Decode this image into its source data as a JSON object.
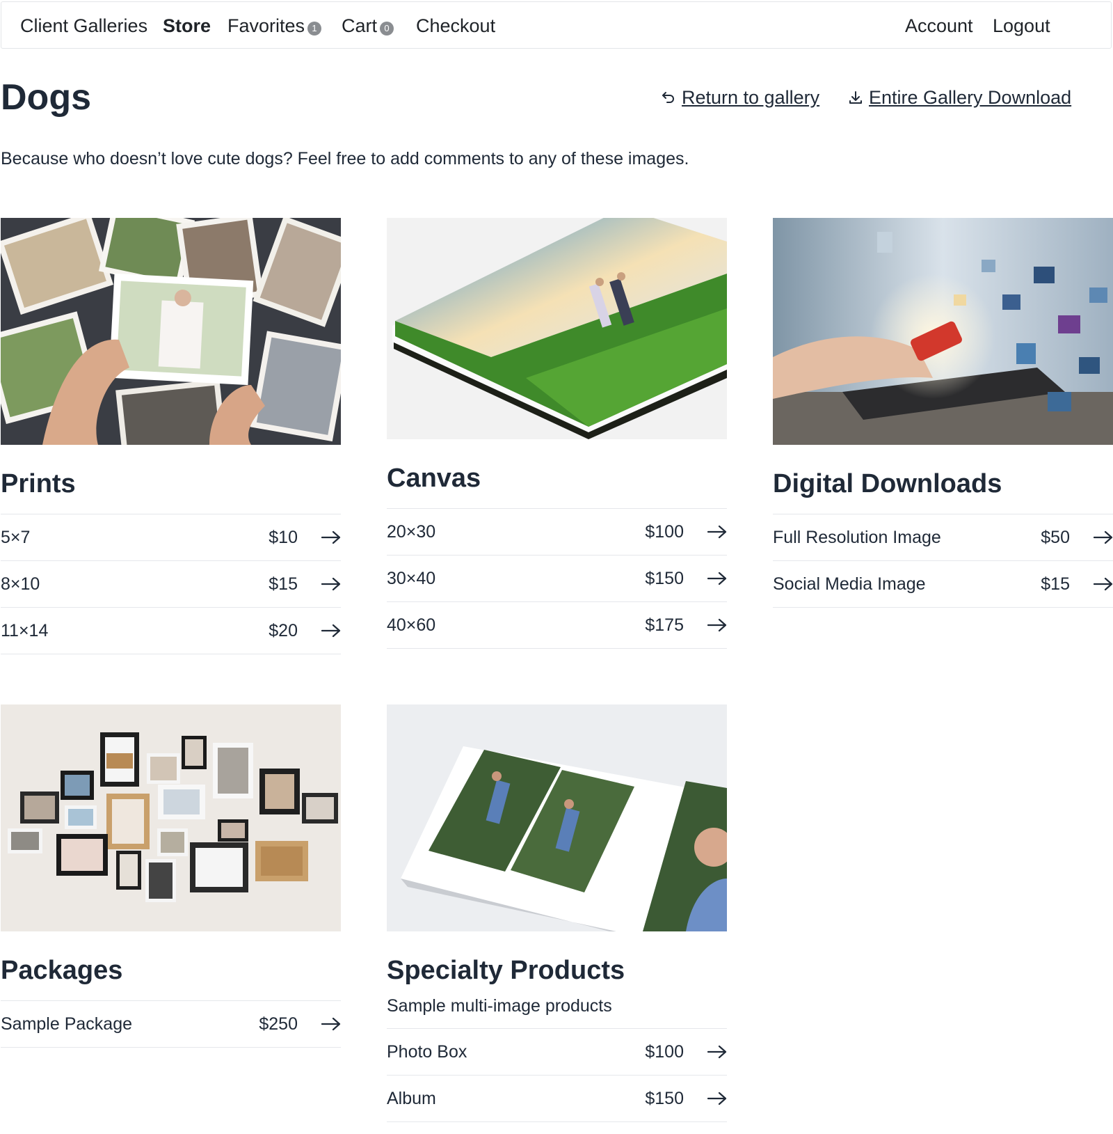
{
  "nav": {
    "items": [
      {
        "label": "Client Galleries"
      },
      {
        "label": "Store"
      },
      {
        "label": "Favorites",
        "badge": "1"
      },
      {
        "label": "Cart",
        "badge": "0"
      },
      {
        "label": "Checkout"
      }
    ],
    "account": "Account",
    "logout": "Logout"
  },
  "header": {
    "title": "Dogs",
    "return_link": "Return to gallery",
    "download_link": "Entire Gallery Download"
  },
  "description": "Because who doesn’t love cute dogs? Feel free to add comments to any of these images.",
  "products": [
    {
      "title": "Prints",
      "image": "prints-photo",
      "rows": [
        {
          "name": "5×7",
          "price": "$10"
        },
        {
          "name": "8×10",
          "price": "$15"
        },
        {
          "name": "11×14",
          "price": "$20"
        }
      ]
    },
    {
      "title": "Canvas",
      "image": "canvas-photo",
      "rows": [
        {
          "name": "20×30",
          "price": "$100"
        },
        {
          "name": "30×40",
          "price": "$150"
        },
        {
          "name": "40×60",
          "price": "$175"
        }
      ]
    },
    {
      "title": "Digital Downloads",
      "image": "digital-photo",
      "rows": [
        {
          "name": "Full Resolution Image",
          "price": "$50"
        },
        {
          "name": "Social Media Image",
          "price": "$15"
        }
      ]
    },
    {
      "title": "Packages",
      "image": "packages-photo",
      "rows": [
        {
          "name": "Sample Package",
          "price": "$250"
        }
      ]
    },
    {
      "title": "Specialty Products",
      "subtitle": "Sample multi-image products",
      "image": "specialty-photo",
      "rows": [
        {
          "name": "Photo Box",
          "price": "$100"
        },
        {
          "name": "Album",
          "price": "$150"
        }
      ]
    }
  ],
  "icons": {
    "return": "return-arrow-icon",
    "download": "download-icon",
    "row_arrow": "arrow-right-icon"
  }
}
